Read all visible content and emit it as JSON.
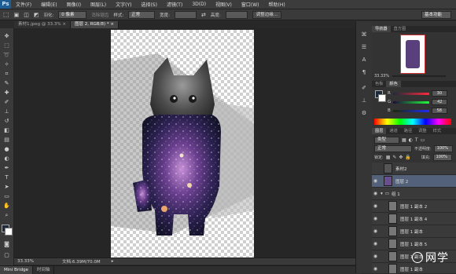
{
  "menubar": {
    "logo": "Ps",
    "items": [
      "文件(F)",
      "编辑(E)",
      "图像(I)",
      "图层(L)",
      "文字(Y)",
      "选择(S)",
      "滤镜(T)",
      "3D(D)",
      "视图(V)",
      "窗口(W)",
      "帮助(H)"
    ]
  },
  "options": {
    "feather_label": "羽化:",
    "feather_value": "0 像素",
    "antialias_label": "消除锯齿",
    "style_label": "样式:",
    "style_value": "正常",
    "width_label": "宽度:",
    "height_label": "高度:",
    "refine_edge": "调整边缘...",
    "workspace": "基本功能"
  },
  "tabs": [
    {
      "label": "素材1.jpeg @ 33.3%"
    },
    {
      "label": "图层 2, RGB/8) *"
    }
  ],
  "status": {
    "zoom": "33.33%",
    "doc_info": "文档:6.39M/70.0M"
  },
  "mini": {
    "tab1": "Mini Bridge",
    "tab2": "时间轴"
  },
  "navigator": {
    "tabs": [
      "导航器",
      "直方图"
    ],
    "zoom": "33.33%"
  },
  "color": {
    "tabs": [
      "色板",
      "颜色"
    ],
    "r": "30",
    "g": "42",
    "b": "58",
    "r_label": "R",
    "g_label": "G",
    "b_label": "B"
  },
  "layers_panel": {
    "tabs": [
      "图层",
      "通道",
      "路径",
      "调整",
      "样式"
    ],
    "kind_label": "类型",
    "blend_mode": "正常",
    "opacity_label": "不透明度:",
    "opacity_value": "100%",
    "lock_label": "锁定:",
    "fill_label": "填充:",
    "fill_value": "100%",
    "layers": [
      {
        "name": "素材2",
        "visible": false,
        "group": false,
        "indent": false
      },
      {
        "name": "图层 2",
        "visible": true,
        "group": false,
        "indent": false
      },
      {
        "name": "组 1",
        "visible": true,
        "group": true,
        "indent": false
      },
      {
        "name": "图层 1 副本 2",
        "visible": true,
        "group": false,
        "indent": true
      },
      {
        "name": "图层 1 副本 4",
        "visible": true,
        "group": false,
        "indent": true
      },
      {
        "name": "图层 1 副本",
        "visible": true,
        "group": false,
        "indent": true
      },
      {
        "name": "图层 1 副本 5",
        "visible": true,
        "group": false,
        "indent": true
      },
      {
        "name": "图层 1 副本",
        "visible": true,
        "group": false,
        "indent": true
      },
      {
        "name": "图层 1 副本",
        "visible": true,
        "group": false,
        "indent": true
      }
    ]
  },
  "watermark": "网学",
  "colors": {
    "accent": "#53627a",
    "fg_swatch": "#1e2a3a",
    "bg_swatch": "#ffffff"
  }
}
